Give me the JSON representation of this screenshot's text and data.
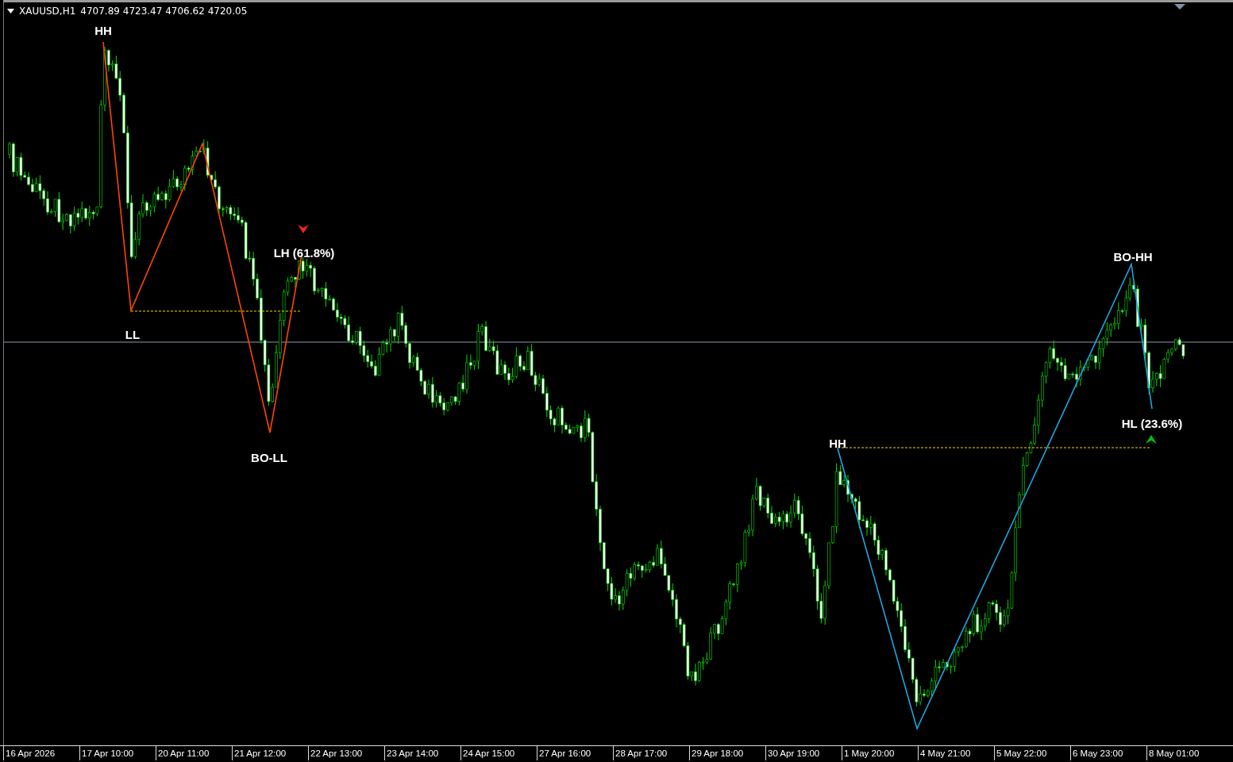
{
  "header": {
    "symbol": "XAUUSD,H1",
    "quote": "4707.89 4723.47 4706.62 4720.05"
  },
  "zigzags": [
    {
      "color": "#ff4500"
    },
    {
      "color": "#1ea7e1"
    }
  ],
  "labels": [
    {
      "text": "HH"
    },
    {
      "text": "LL"
    },
    {
      "text": "BO-LL"
    },
    {
      "text": "LH (61.8%)"
    },
    {
      "text": "HH"
    },
    {
      "text": "BO-HH"
    },
    {
      "text": "HL (23.6%)"
    }
  ],
  "signals": [
    {
      "kind": "sell"
    },
    {
      "kind": "buy"
    }
  ],
  "time_axis": [
    "16 Apr 2026",
    "17 Apr 10:00",
    "20 Apr 11:00",
    "21 Apr 12:00",
    "22 Apr 13:00",
    "23 Apr 14:00",
    "24 Apr 15:00",
    "27 Apr 16:00",
    "28 Apr 17:00",
    "29 Apr 18:00",
    "30 Apr 19:00",
    "1 May 20:00",
    "4 May 21:00",
    "5 May 22:00",
    "6 May 23:00",
    "8 May 01:00"
  ]
}
